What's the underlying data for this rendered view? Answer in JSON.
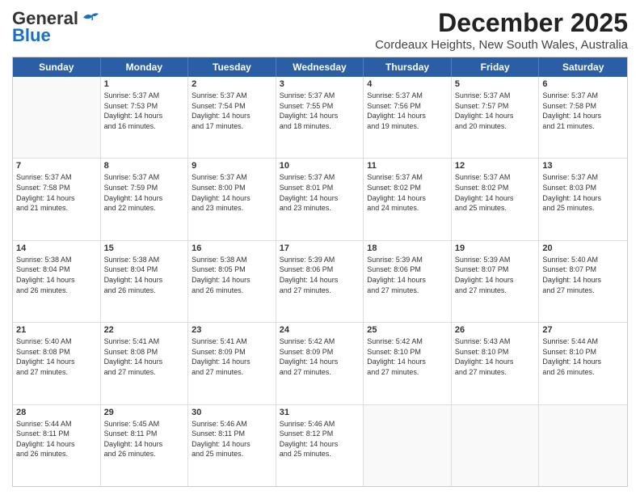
{
  "header": {
    "logo_general": "General",
    "logo_blue": "Blue",
    "main_title": "December 2025",
    "subtitle": "Cordeaux Heights, New South Wales, Australia"
  },
  "calendar": {
    "days_of_week": [
      "Sunday",
      "Monday",
      "Tuesday",
      "Wednesday",
      "Thursday",
      "Friday",
      "Saturday"
    ],
    "weeks": [
      [
        {
          "day": "",
          "content": ""
        },
        {
          "day": "1",
          "content": "Sunrise: 5:37 AM\nSunset: 7:53 PM\nDaylight: 14 hours\nand 16 minutes."
        },
        {
          "day": "2",
          "content": "Sunrise: 5:37 AM\nSunset: 7:54 PM\nDaylight: 14 hours\nand 17 minutes."
        },
        {
          "day": "3",
          "content": "Sunrise: 5:37 AM\nSunset: 7:55 PM\nDaylight: 14 hours\nand 18 minutes."
        },
        {
          "day": "4",
          "content": "Sunrise: 5:37 AM\nSunset: 7:56 PM\nDaylight: 14 hours\nand 19 minutes."
        },
        {
          "day": "5",
          "content": "Sunrise: 5:37 AM\nSunset: 7:57 PM\nDaylight: 14 hours\nand 20 minutes."
        },
        {
          "day": "6",
          "content": "Sunrise: 5:37 AM\nSunset: 7:58 PM\nDaylight: 14 hours\nand 21 minutes."
        }
      ],
      [
        {
          "day": "7",
          "content": "Sunrise: 5:37 AM\nSunset: 7:58 PM\nDaylight: 14 hours\nand 21 minutes."
        },
        {
          "day": "8",
          "content": "Sunrise: 5:37 AM\nSunset: 7:59 PM\nDaylight: 14 hours\nand 22 minutes."
        },
        {
          "day": "9",
          "content": "Sunrise: 5:37 AM\nSunset: 8:00 PM\nDaylight: 14 hours\nand 23 minutes."
        },
        {
          "day": "10",
          "content": "Sunrise: 5:37 AM\nSunset: 8:01 PM\nDaylight: 14 hours\nand 23 minutes."
        },
        {
          "day": "11",
          "content": "Sunrise: 5:37 AM\nSunset: 8:02 PM\nDaylight: 14 hours\nand 24 minutes."
        },
        {
          "day": "12",
          "content": "Sunrise: 5:37 AM\nSunset: 8:02 PM\nDaylight: 14 hours\nand 25 minutes."
        },
        {
          "day": "13",
          "content": "Sunrise: 5:37 AM\nSunset: 8:03 PM\nDaylight: 14 hours\nand 25 minutes."
        }
      ],
      [
        {
          "day": "14",
          "content": "Sunrise: 5:38 AM\nSunset: 8:04 PM\nDaylight: 14 hours\nand 26 minutes."
        },
        {
          "day": "15",
          "content": "Sunrise: 5:38 AM\nSunset: 8:04 PM\nDaylight: 14 hours\nand 26 minutes."
        },
        {
          "day": "16",
          "content": "Sunrise: 5:38 AM\nSunset: 8:05 PM\nDaylight: 14 hours\nand 26 minutes."
        },
        {
          "day": "17",
          "content": "Sunrise: 5:39 AM\nSunset: 8:06 PM\nDaylight: 14 hours\nand 27 minutes."
        },
        {
          "day": "18",
          "content": "Sunrise: 5:39 AM\nSunset: 8:06 PM\nDaylight: 14 hours\nand 27 minutes."
        },
        {
          "day": "19",
          "content": "Sunrise: 5:39 AM\nSunset: 8:07 PM\nDaylight: 14 hours\nand 27 minutes."
        },
        {
          "day": "20",
          "content": "Sunrise: 5:40 AM\nSunset: 8:07 PM\nDaylight: 14 hours\nand 27 minutes."
        }
      ],
      [
        {
          "day": "21",
          "content": "Sunrise: 5:40 AM\nSunset: 8:08 PM\nDaylight: 14 hours\nand 27 minutes."
        },
        {
          "day": "22",
          "content": "Sunrise: 5:41 AM\nSunset: 8:08 PM\nDaylight: 14 hours\nand 27 minutes."
        },
        {
          "day": "23",
          "content": "Sunrise: 5:41 AM\nSunset: 8:09 PM\nDaylight: 14 hours\nand 27 minutes."
        },
        {
          "day": "24",
          "content": "Sunrise: 5:42 AM\nSunset: 8:09 PM\nDaylight: 14 hours\nand 27 minutes."
        },
        {
          "day": "25",
          "content": "Sunrise: 5:42 AM\nSunset: 8:10 PM\nDaylight: 14 hours\nand 27 minutes."
        },
        {
          "day": "26",
          "content": "Sunrise: 5:43 AM\nSunset: 8:10 PM\nDaylight: 14 hours\nand 27 minutes."
        },
        {
          "day": "27",
          "content": "Sunrise: 5:44 AM\nSunset: 8:10 PM\nDaylight: 14 hours\nand 26 minutes."
        }
      ],
      [
        {
          "day": "28",
          "content": "Sunrise: 5:44 AM\nSunset: 8:11 PM\nDaylight: 14 hours\nand 26 minutes."
        },
        {
          "day": "29",
          "content": "Sunrise: 5:45 AM\nSunset: 8:11 PM\nDaylight: 14 hours\nand 26 minutes."
        },
        {
          "day": "30",
          "content": "Sunrise: 5:46 AM\nSunset: 8:11 PM\nDaylight: 14 hours\nand 25 minutes."
        },
        {
          "day": "31",
          "content": "Sunrise: 5:46 AM\nSunset: 8:12 PM\nDaylight: 14 hours\nand 25 minutes."
        },
        {
          "day": "",
          "content": ""
        },
        {
          "day": "",
          "content": ""
        },
        {
          "day": "",
          "content": ""
        }
      ]
    ]
  }
}
